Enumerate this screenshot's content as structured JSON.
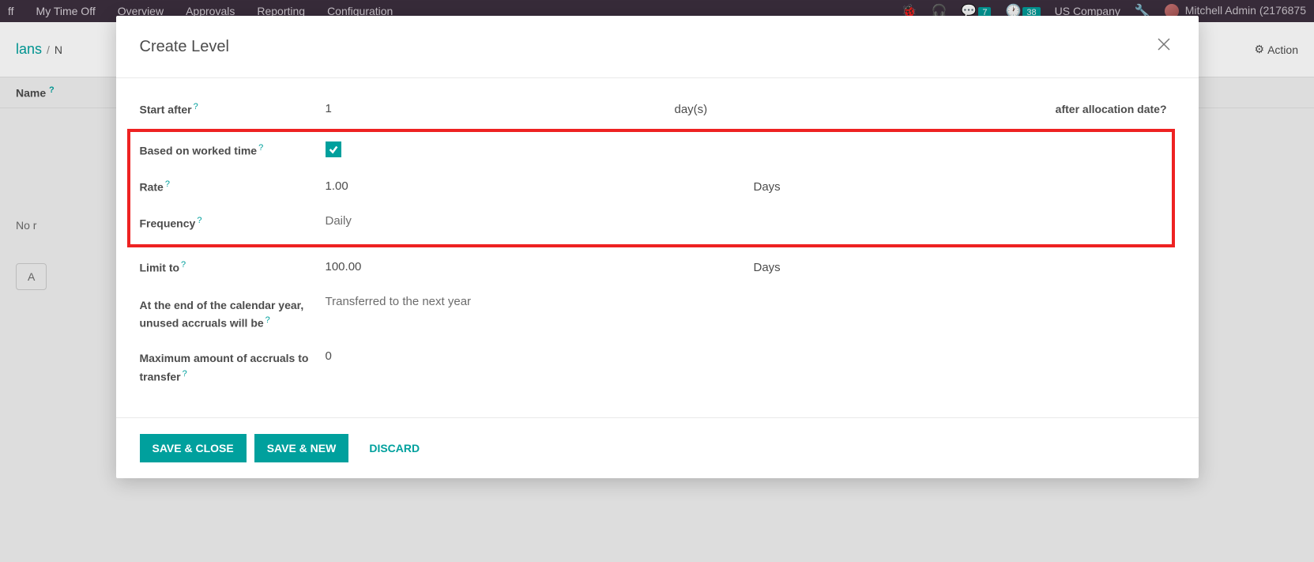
{
  "nav": {
    "items": [
      "ff",
      "My Time Off",
      "Overview",
      "Approvals",
      "Reporting",
      "Configuration"
    ],
    "badge_messages": "7",
    "badge_activities": "38",
    "company": "US Company",
    "user": "Mitchell Admin (2176875"
  },
  "breadcrumb": {
    "part1": "lans",
    "sep": "/",
    "part2": "N",
    "action": "Action"
  },
  "page": {
    "name_label": "Name",
    "no_record": "No r",
    "add_btn": "A"
  },
  "modal": {
    "title": "Create Level",
    "fields": {
      "start_after": {
        "label": "Start after",
        "value": "1",
        "unit": "day(s)",
        "after": "after allocation date"
      },
      "worked_time": {
        "label": "Based on worked time",
        "checked": true
      },
      "rate": {
        "label": "Rate",
        "value": "1.00",
        "unit": "Days"
      },
      "frequency": {
        "label": "Frequency",
        "value": "Daily"
      },
      "limit": {
        "label": "Limit to",
        "value": "100.00",
        "unit": "Days"
      },
      "year_end": {
        "label": "At the end of the calendar year, unused accruals will be",
        "value": "Transferred to the next year"
      },
      "max_transfer": {
        "label": "Maximum amount of accruals to transfer",
        "value": "0"
      }
    },
    "buttons": {
      "save_close": "Save & Close",
      "save_new": "Save & New",
      "discard": "Discard"
    }
  }
}
